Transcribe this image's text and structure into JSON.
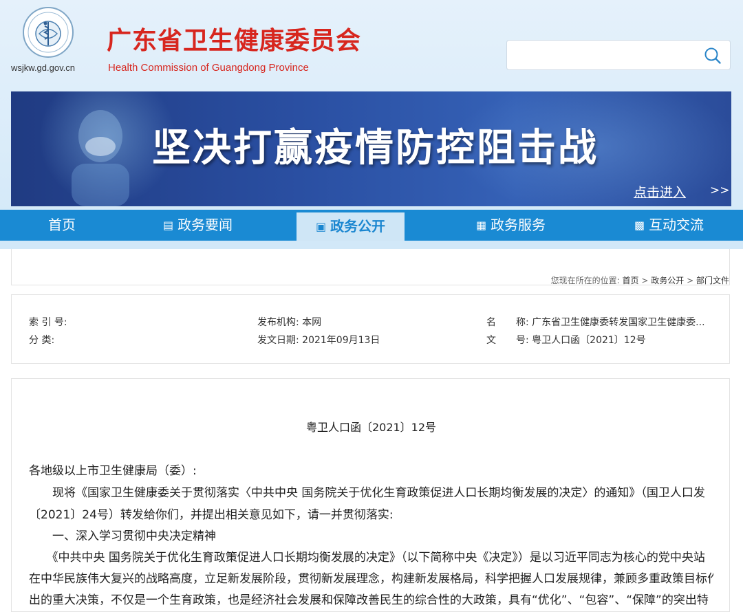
{
  "header": {
    "domain": "wsjkw.gd.gov.cn",
    "title": "广东省卫生健康委员会",
    "subtitle": "Health Commission of Guangdong Province",
    "search_placeholder": "",
    "search_icon": "search-icon"
  },
  "banner": {
    "slogan": "坚决打赢疫情防控阻击战",
    "link": "点击进入",
    "link_arrows": ">>"
  },
  "nav": {
    "items": [
      {
        "label": "首页",
        "icon": ""
      },
      {
        "label": "政务要闻",
        "icon": "news-icon"
      },
      {
        "label": "政务公开",
        "icon": "open-doc-icon"
      },
      {
        "label": "政务服务",
        "icon": "service-icon"
      },
      {
        "label": "互动交流",
        "icon": "chat-icon"
      }
    ],
    "active_index": 2,
    "colors": {
      "bar": "#1a8ad3",
      "active_bg": "#cfe6f6",
      "active_text": "#1a86d0"
    }
  },
  "breadcrumb": {
    "prefix": "您现在所在的位置:",
    "items": [
      "首页",
      "政务公开",
      "部门文件"
    ],
    "separator": ">"
  },
  "meta": {
    "index_label": "索 引 号:",
    "index_value": "",
    "category_label": "分 类:",
    "category_value": "",
    "publisher": "发布机构: 本网",
    "date": "发文日期: 2021年09月13日",
    "name_char": "名",
    "name": "称: 广东省卫生健康委转发国家卫生健康委...",
    "docno_char": "文",
    "docno": "号: 粤卫人口函〔2021〕12号"
  },
  "document": {
    "number": "粤卫人口函〔2021〕12号",
    "lines": [
      "各地级以上市卫生健康局（委）:",
      "　　现将《国家卫生健康委关于贯彻落实〈中共中央 国务院关于优化生育政策促进人口长期均衡发展的决定〉的通知》（国卫人口发",
      "〔2021〕24号）转发给你们，并提出相关意见如下，请一并贯彻落实:",
      "　　一、深入学习贯彻中央决定精神",
      "　　《中共中央 国务院关于优化生育政策促进人口长期均衡发展的决定》（以下简称中央《决定》）是以习近平同志为核心的党中央站",
      "在中华民族伟大复兴的战略高度，立足新发展阶段，贯彻新发展理念，构建新发展格局，科学把握人口发展规律，兼顾多重政策目标作",
      "出的重大决策，不仅是一个生育政策，也是经济社会发展和保障改善民生的综合性的大政策，具有“优化”、“包容”、“保障”的突出特"
    ]
  },
  "colors": {
    "brand_red": "#d7261e",
    "banner_blue": "#2a4fa2"
  }
}
